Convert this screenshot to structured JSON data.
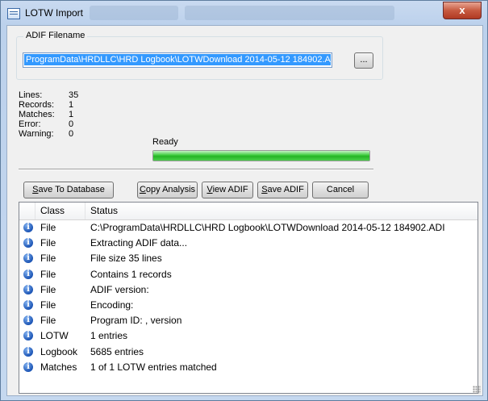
{
  "window": {
    "title": "LOTW Import",
    "close_label": "x"
  },
  "adif": {
    "group_label": "ADIF Filename",
    "filename": "ProgramData\\HRDLLC\\HRD Logbook\\LOTWDownload 2014-05-12 184902.ADI",
    "browse_label": "..."
  },
  "stats": [
    {
      "label": "Lines:",
      "value": "35"
    },
    {
      "label": "Records:",
      "value": "1"
    },
    {
      "label": "Matches:",
      "value": "1"
    },
    {
      "label": "Error:",
      "value": "0"
    },
    {
      "label": "Warning:",
      "value": "0"
    }
  ],
  "progress": {
    "status": "Ready",
    "fraction": 1.0
  },
  "buttons": {
    "save_db": {
      "key": "S",
      "rest": "ave To Database"
    },
    "copy_analysis": {
      "key": "C",
      "rest": "opy Analysis"
    },
    "view_adif": {
      "key": "V",
      "rest": "iew ADIF"
    },
    "save_adif": {
      "key": "S",
      "rest": "ave ADIF"
    },
    "cancel": "Cancel"
  },
  "table": {
    "columns": [
      "Class",
      "Status"
    ],
    "rows": [
      {
        "class": "File",
        "status": "C:\\ProgramData\\HRDLLC\\HRD Logbook\\LOTWDownload 2014-05-12 184902.ADI"
      },
      {
        "class": "File",
        "status": "Extracting ADIF data..."
      },
      {
        "class": "File",
        "status": "File size 35 lines"
      },
      {
        "class": "File",
        "status": "Contains 1 records"
      },
      {
        "class": "File",
        "status": "ADIF version:"
      },
      {
        "class": "File",
        "status": "Encoding:"
      },
      {
        "class": "File",
        "status": "Program ID:  , version"
      },
      {
        "class": "LOTW",
        "status": "1 entries"
      },
      {
        "class": "Logbook",
        "status": "5685 entries"
      },
      {
        "class": "Matches",
        "status": "1 of 1 LOTW entries matched"
      }
    ]
  },
  "icons": {
    "row_icon": "info-icon",
    "app_icon": "window-icon",
    "close": "close-icon"
  },
  "colors": {
    "progress": "#25b425",
    "selection": "#3399ff",
    "info": "#1c55b5"
  }
}
